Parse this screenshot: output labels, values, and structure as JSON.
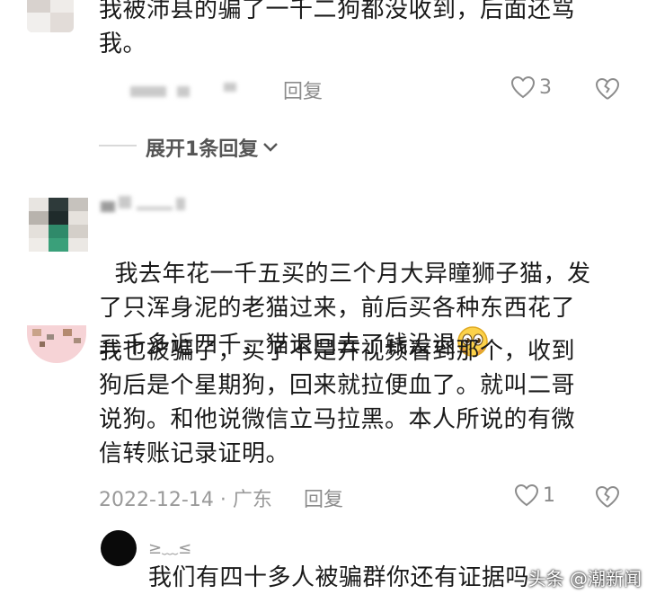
{
  "comments": [
    {
      "text": "我被沛县的骗了一千二狗都没收到，后面还骂\n我。",
      "reply_label": "回复",
      "likes": "3"
    },
    {
      "expand_label": "展开1条回复"
    },
    {
      "text": "我去年花一千五买的三个月大异瞳狮子猫，发\n了只浑身泥的老猫过来，前后买各种东西花了\n三千多近四千，猫退回去了钱没退"
    },
    {
      "text": "我也被骗了，买了不是开视频看到那个，收到\n狗后是个星期狗，回来就拉便血了。就叫二哥\n说狗。和他说微信立马拉黑。本人所说的有微\n信转账记录证明。",
      "date_location": "2022-12-14 · 广东",
      "reply_label": "回复",
      "likes": "1"
    },
    {
      "username": "≥﹏≤",
      "text": "我们有四十多人被骗群你还有证据吗"
    }
  ],
  "watermark": "头条 @潮新闻",
  "icons": {
    "like": "heart-outline-icon",
    "dislike": "broken-heart-icon",
    "expand": "chevron-down-icon",
    "emoji": "pleading-face-emoji"
  }
}
